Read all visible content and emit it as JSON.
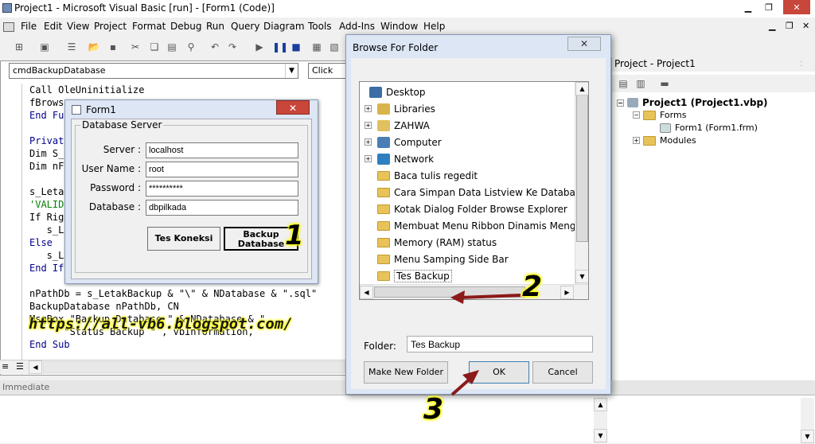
{
  "window": {
    "title": "Project1 - Microsoft Visual Basic [run] - [Form1 (Code)]"
  },
  "menu": [
    "File",
    "Edit",
    "View",
    "Project",
    "Format",
    "Debug",
    "Run",
    "Query",
    "Diagram",
    "Tools",
    "Add-Ins",
    "Window",
    "Help"
  ],
  "code": {
    "object_combo": "cmdBackupDatabase",
    "proc_combo": "Click",
    "lines": [
      {
        "t": "Call OleUninitialize",
        "c": "black"
      },
      {
        "t": "fBrows",
        "c": "black"
      },
      {
        "t": "End Fu",
        "c": "blue"
      },
      {
        "t": "",
        "c": "black"
      },
      {
        "t": "Privat",
        "c": "blue"
      },
      {
        "t": "Dim S_",
        "c": "black"
      },
      {
        "t": "Dim nF",
        "c": "black"
      },
      {
        "t": "",
        "c": "black"
      },
      {
        "t": "s_Leta                                     Dire",
        "c": "black"
      },
      {
        "t": "'VALID",
        "c": "green"
      },
      {
        "t": "If Rig",
        "c": "black"
      },
      {
        "t": "   s_L",
        "c": "black"
      },
      {
        "t": "Else",
        "c": "blue"
      },
      {
        "t": "   s_L",
        "c": "black"
      },
      {
        "t": "End If",
        "c": "blue"
      },
      {
        "t": "",
        "c": "black"
      },
      {
        "t": "nPathDb = s_LetakBackup & \"\\\" & NDatabase & \".sql\"",
        "c": "black"
      },
      {
        "t": "BackupDatabase nPathDb, CN",
        "c": "black"
      },
      {
        "t": "MsgBox \"Backup Database \" & NDatabase & \"",
        "c": "black"
      },
      {
        "t": "      \"Status Backup \" , vbInformation,",
        "c": "black"
      },
      {
        "t": "End Sub",
        "c": "blue"
      }
    ]
  },
  "watermark": "https://all-vb6.blogspot.com/",
  "immediate": {
    "title": "Immediate"
  },
  "form1": {
    "title": "Form1",
    "close": "✕",
    "group": "Database Server",
    "server_label": "Server :",
    "server_value": "localhost",
    "user_label": "User Name :",
    "user_value": "root",
    "password_label": "Password :",
    "password_value": "**********",
    "database_label": "Database :",
    "database_value": "dbpilkada",
    "btn_test": "Tes Koneksi",
    "btn_backup_1": "Backup",
    "btn_backup_2": "Database"
  },
  "dialog": {
    "title": "Browse For Folder",
    "close": "✕",
    "items": [
      {
        "label": "Desktop",
        "icon": "desktop-icon"
      },
      {
        "label": "Libraries",
        "icon": "libraries-icon"
      },
      {
        "label": "ZAHWA",
        "icon": "user-folder-icon"
      },
      {
        "label": "Computer",
        "icon": "computer-icon"
      },
      {
        "label": "Network",
        "icon": "network-icon"
      },
      {
        "label": "Baca tulis regedit",
        "icon": "folder-icon"
      },
      {
        "label": "Cara Simpan Data Listview Ke Database MyS",
        "icon": "folder-icon"
      },
      {
        "label": "Kotak Dialog Folder Browse Explorer",
        "icon": "folder-icon"
      },
      {
        "label": "Membuat Menu Ribbon  Dinamis Menggun",
        "icon": "folder-icon"
      },
      {
        "label": "Memory (RAM) status",
        "icon": "folder-icon"
      },
      {
        "label": "Menu Samping Side Bar",
        "icon": "folder-icon"
      },
      {
        "label": "Tes Backup",
        "icon": "folder-icon"
      }
    ],
    "folder_label": "Folder:",
    "folder_value": "Tes Backup",
    "btn_new": "Make New Folder",
    "btn_ok": "OK",
    "btn_cancel": "Cancel"
  },
  "annotations": {
    "n1": "1",
    "n2": "2",
    "n3": "3"
  },
  "project": {
    "title": "Project - Project1",
    "root": "Project1 (Project1.vbp)",
    "forms": "Forms",
    "form1": "Form1 (Form1.frm)",
    "modules": "Modules"
  }
}
